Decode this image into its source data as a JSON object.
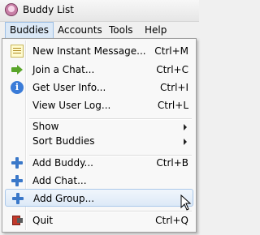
{
  "window": {
    "title": "Buddy List"
  },
  "menubar": [
    {
      "label": "Buddies",
      "active": true
    },
    {
      "label": "Accounts",
      "active": false
    },
    {
      "label": "Tools",
      "active": false
    },
    {
      "label": "Help",
      "active": false
    }
  ],
  "menu": {
    "items": [
      {
        "label": "New Instant Message...",
        "shortcut": "Ctrl+M",
        "icon": "message-icon"
      },
      {
        "label": "Join a Chat...",
        "shortcut": "Ctrl+C",
        "icon": "chat-arrow-icon"
      },
      {
        "label": "Get User Info...",
        "shortcut": "Ctrl+I",
        "icon": "info-icon"
      },
      {
        "label": "View User Log...",
        "shortcut": "Ctrl+L",
        "icon": ""
      },
      {
        "label": "Show",
        "shortcut": "",
        "submenu": true
      },
      {
        "label": "Sort Buddies",
        "shortcut": "",
        "submenu": true
      },
      {
        "label": "Add Buddy...",
        "shortcut": "Ctrl+B",
        "icon": "plus-icon"
      },
      {
        "label": "Add Chat...",
        "shortcut": "",
        "icon": "plus-icon"
      },
      {
        "label": "Add Group...",
        "shortcut": "",
        "icon": "plus-icon",
        "hovered": true
      },
      {
        "label": "Quit",
        "shortcut": "Ctrl+Q",
        "icon": "quit-icon"
      }
    ]
  },
  "icons": {
    "info_glyph": "i"
  },
  "colors": {
    "hover_bg": "#dce9f7",
    "hover_border": "#aac8ea",
    "accent_blue": "#3a78c9"
  }
}
